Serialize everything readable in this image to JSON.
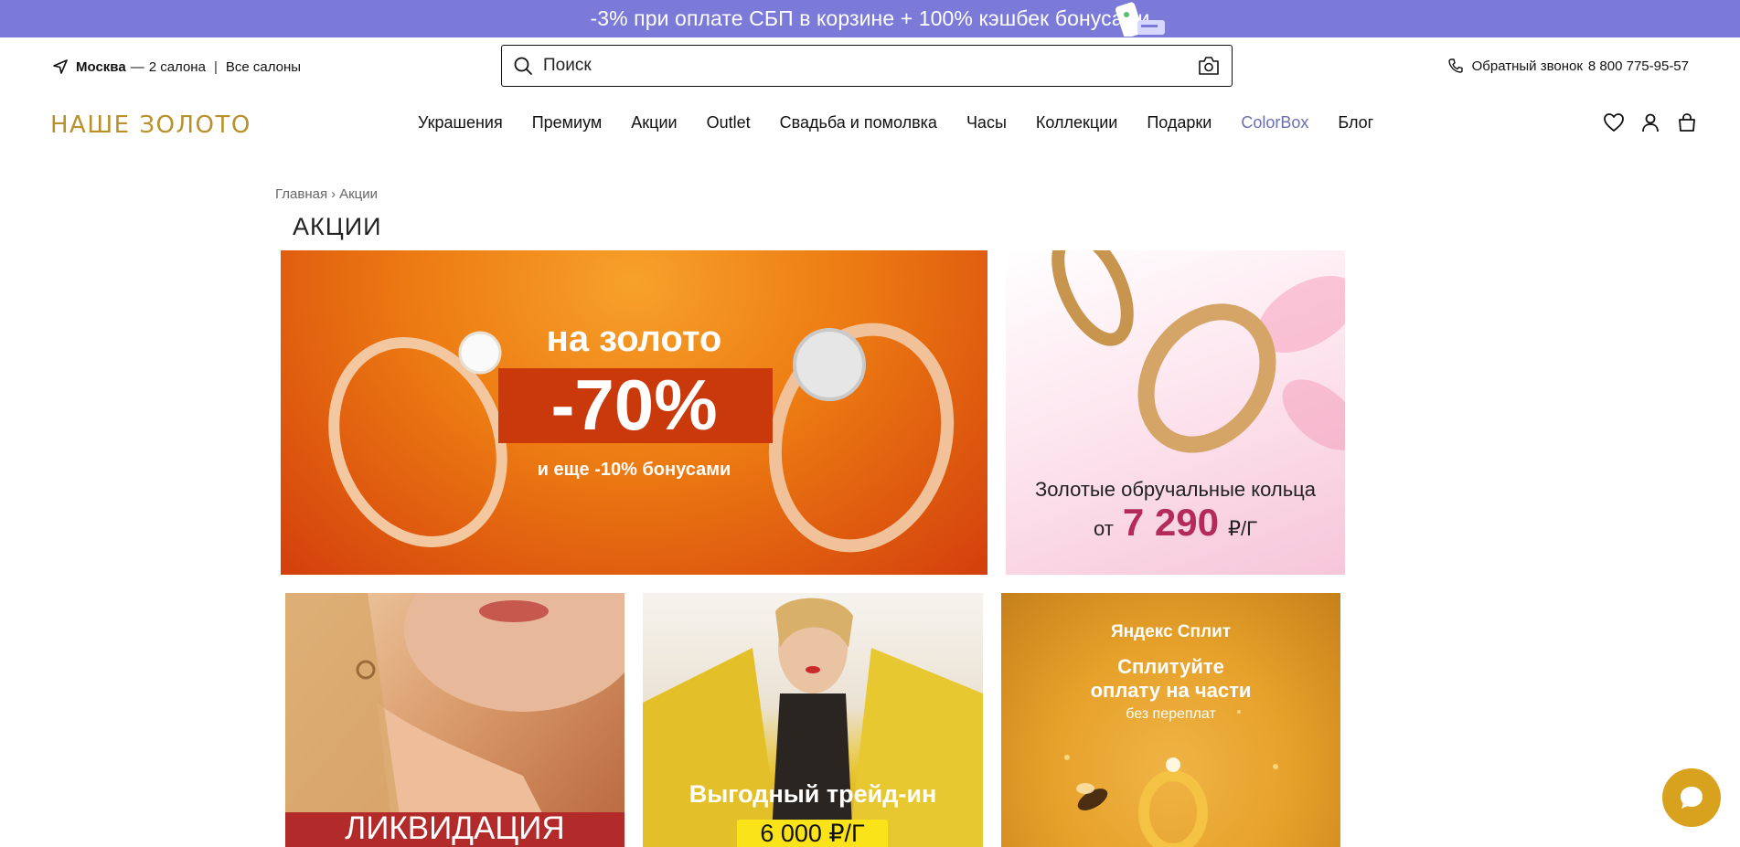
{
  "promo": {
    "text": "-3% при оплате СБП в корзине + 100% кэшбек бонусами"
  },
  "header": {
    "city": "Москва",
    "dash": "—",
    "salons_count": "2 салона",
    "separator": "|",
    "all_salons": "Все салоны",
    "search_placeholder": "Поиск",
    "callback_label": "Обратный звонок",
    "phone": "8 800 775-95-57"
  },
  "logo": {
    "text": "НАШЕ ЗОЛОТО"
  },
  "nav": {
    "items": [
      {
        "label": "Украшения"
      },
      {
        "label": "Премиум"
      },
      {
        "label": "Акции"
      },
      {
        "label": "Outlet"
      },
      {
        "label": "Свадьба и помолвка"
      },
      {
        "label": "Часы"
      },
      {
        "label": "Коллекции"
      },
      {
        "label": "Подарки"
      },
      {
        "label": "ColorBox"
      },
      {
        "label": "Блог"
      }
    ]
  },
  "icons": [
    "heart-icon",
    "user-icon",
    "bag-icon"
  ],
  "breadcrumb": {
    "home": "Главная",
    "arrow": "›",
    "current": "Акции"
  },
  "page_title": "АКЦИИ",
  "banners": {
    "gold_sale": {
      "line1": "на золото",
      "discount": "-70%",
      "line3": "и еще -10% бонусами"
    },
    "wedding_rings": {
      "title": "Золотые обручальные кольца",
      "prefix": "от",
      "price": "7 290",
      "unit": "₽/Г"
    },
    "liquidation": {
      "title": "ЛИКВИДАЦИЯ"
    },
    "trade_in": {
      "title": "Выгодный трейд-ин",
      "price": "6 000 ₽/Г"
    },
    "split": {
      "brand": "Яндекс Сплит",
      "line1": "Сплитуйте",
      "line2": "оплату на части",
      "line3": "без переплат"
    }
  },
  "colors": {
    "promo_bg": "#7b7ad9",
    "logo": "#b8912d",
    "colorbox": "#6c6fae",
    "price_accent": "#b32a5b",
    "chat": "#d9a21e"
  }
}
